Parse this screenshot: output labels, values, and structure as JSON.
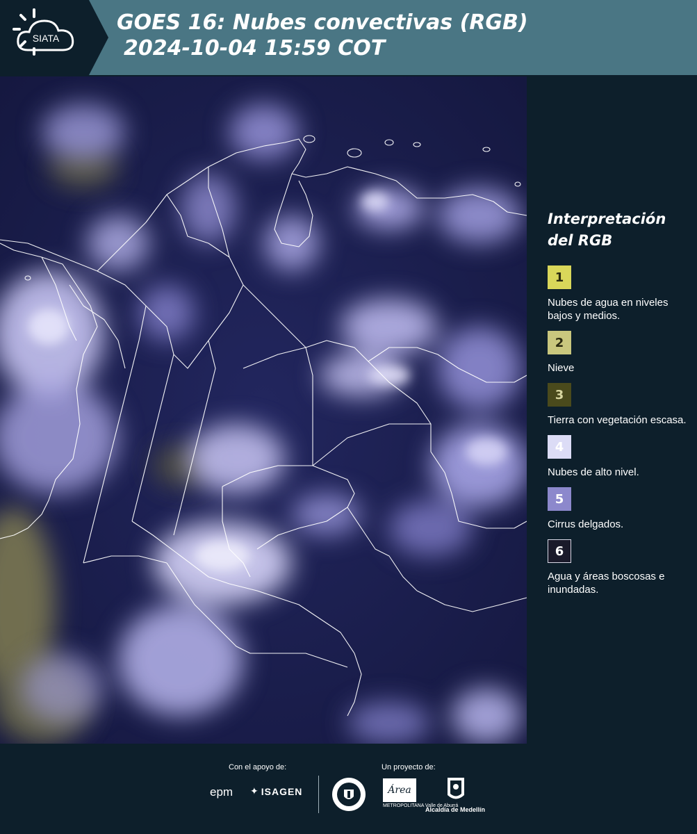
{
  "header": {
    "logo_text": "SIATA",
    "title_line1": "GOES 16: Nubes convectivas (RGB)",
    "title_line2": "2024-10-04 15:59 COT",
    "background": "#4a7684"
  },
  "legend": {
    "title_line1": "Interpretación",
    "title_line2": "del RGB",
    "items": [
      {
        "num": "1",
        "label": "Nubes de agua en niveles bajos y medios.",
        "color": "#d9d75a"
      },
      {
        "num": "2",
        "label": "Nieve",
        "color": "#c9c77e"
      },
      {
        "num": "3",
        "label": "Tierra con vegetación escasa.",
        "color": "#4a4a1c"
      },
      {
        "num": "4",
        "label": "Nubes de alto nivel.",
        "color": "#dcdcf6"
      },
      {
        "num": "5",
        "label": "Cirrus delgados.",
        "color": "#8c88cc"
      },
      {
        "num": "6",
        "label": "Agua y áreas boscosas e inundadas.",
        "color": "#1a1a2a"
      }
    ]
  },
  "footer": {
    "support_label": "Con el apoyo de:",
    "project_label": "Un proyecto de:",
    "sponsor1": "epm",
    "sponsor2": "ISAGEN",
    "amva_logo_text": "Área",
    "amva_sub": "METROPOLITANA Valle de Aburrá",
    "alcaldia": "Alcaldía de Medellín"
  }
}
